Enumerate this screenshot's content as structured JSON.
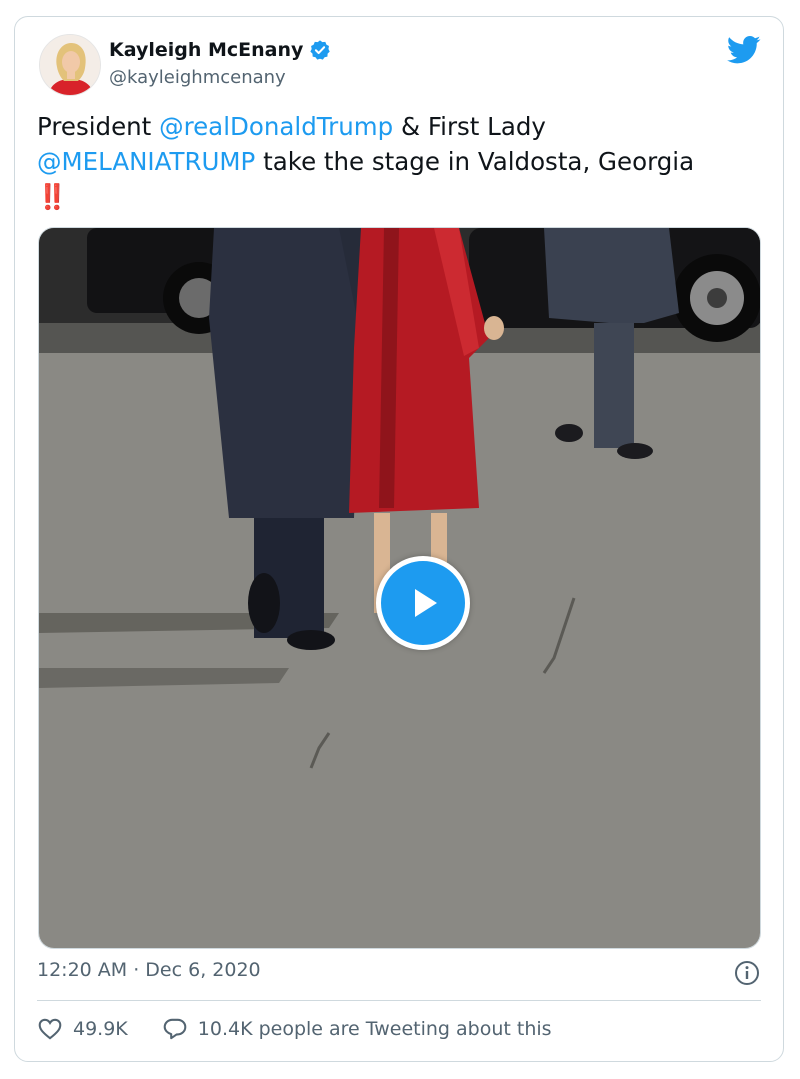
{
  "author": {
    "display_name": "Kayleigh McEnany",
    "handle": "@kayleighmcenany",
    "verified_icon": "verified-badge-icon",
    "avatar_icon": "profile-avatar"
  },
  "brand": {
    "icon": "twitter-bird-icon",
    "color": "#1d9bf0"
  },
  "tweet": {
    "text_part1": "President ",
    "mention1": "@realDonaldTrump",
    "text_part2": " & First Lady ",
    "mention2": "@MELANIATRUMP",
    "text_part3": " take the stage in Valdosta, Georgia ",
    "emoji": "‼️"
  },
  "media": {
    "type": "video",
    "play_icon": "play-icon"
  },
  "meta": {
    "timestamp": "12:20 AM · Dec 6, 2020",
    "info_icon": "info-icon"
  },
  "actions": {
    "likes": "49.9K",
    "replies_text": "10.4K people are Tweeting about this",
    "like_icon": "heart-icon",
    "reply_icon": "reply-bubble-icon"
  },
  "colors": {
    "accent": "#1d9bf0",
    "text_primary": "#0f1419",
    "text_secondary": "#536471",
    "border": "#cfd9de"
  }
}
